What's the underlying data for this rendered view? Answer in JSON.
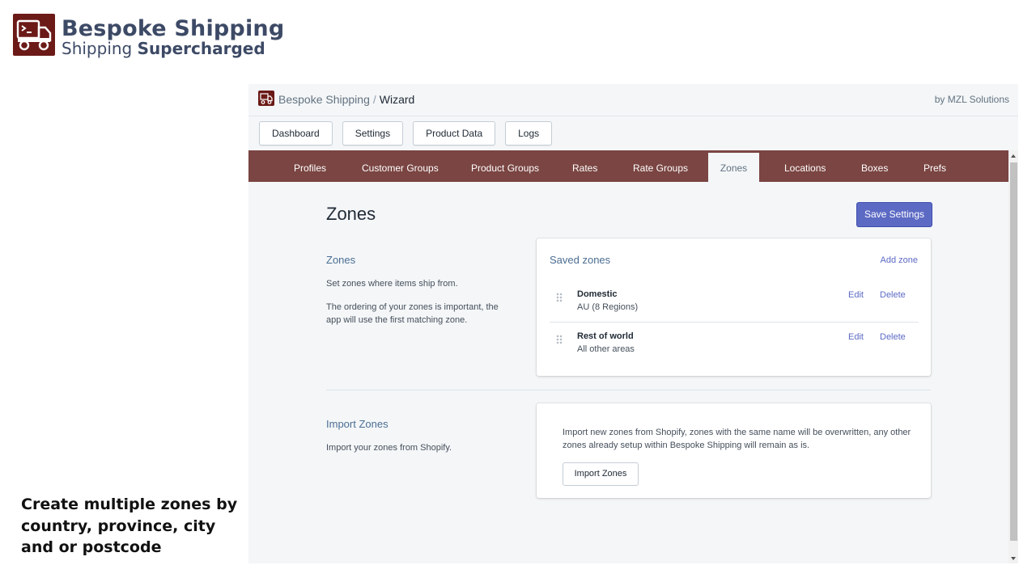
{
  "branding": {
    "title": "Bespoke Shipping",
    "subtitle_prefix": "Shipping",
    "subtitle_strong": "Supercharged",
    "logo_icon": "truck-icon"
  },
  "caption": "Create multiple zones by country, province, city and or postcode",
  "header": {
    "app_name": "Bespoke Shipping",
    "separator": "/",
    "current": "Wizard",
    "byline": "by MZL Solutions"
  },
  "toolbar": [
    "Dashboard",
    "Settings",
    "Product Data",
    "Logs"
  ],
  "tabs": [
    {
      "label": "Profiles",
      "active": false
    },
    {
      "label": "Customer Groups",
      "active": false
    },
    {
      "label": "Product Groups",
      "active": false
    },
    {
      "label": "Rates",
      "active": false
    },
    {
      "label": "Rate Groups",
      "active": false
    },
    {
      "label": "Zones",
      "active": true
    },
    {
      "label": "Locations",
      "active": false
    },
    {
      "label": "Boxes",
      "active": false
    },
    {
      "label": "Prefs",
      "active": false
    }
  ],
  "page": {
    "title": "Zones",
    "save_label": "Save Settings"
  },
  "zones_section": {
    "heading": "Zones",
    "text1": "Set zones where items ship from.",
    "text2": "The ordering of your zones is important, the app will use the first matching zone.",
    "card_title": "Saved zones",
    "add_label": "Add zone",
    "items": [
      {
        "name": "Domestic",
        "desc": "AU (8 Regions)",
        "edit": "Edit",
        "delete": "Delete"
      },
      {
        "name": "Rest of world",
        "desc": "All other areas",
        "edit": "Edit",
        "delete": "Delete"
      }
    ]
  },
  "import_section": {
    "heading": "Import Zones",
    "text": "Import your zones from Shopify.",
    "card_text": "Import new zones from Shopify, zones with the same name will be overwritten, any other zones already setup within Bespoke Shipping will remain as is.",
    "button_label": "Import Zones"
  },
  "colors": {
    "nav_bg": "#7a4542",
    "primary": "#5c6ac4",
    "brand": "#6b1a17",
    "heading_blue": "#4b6e92"
  }
}
